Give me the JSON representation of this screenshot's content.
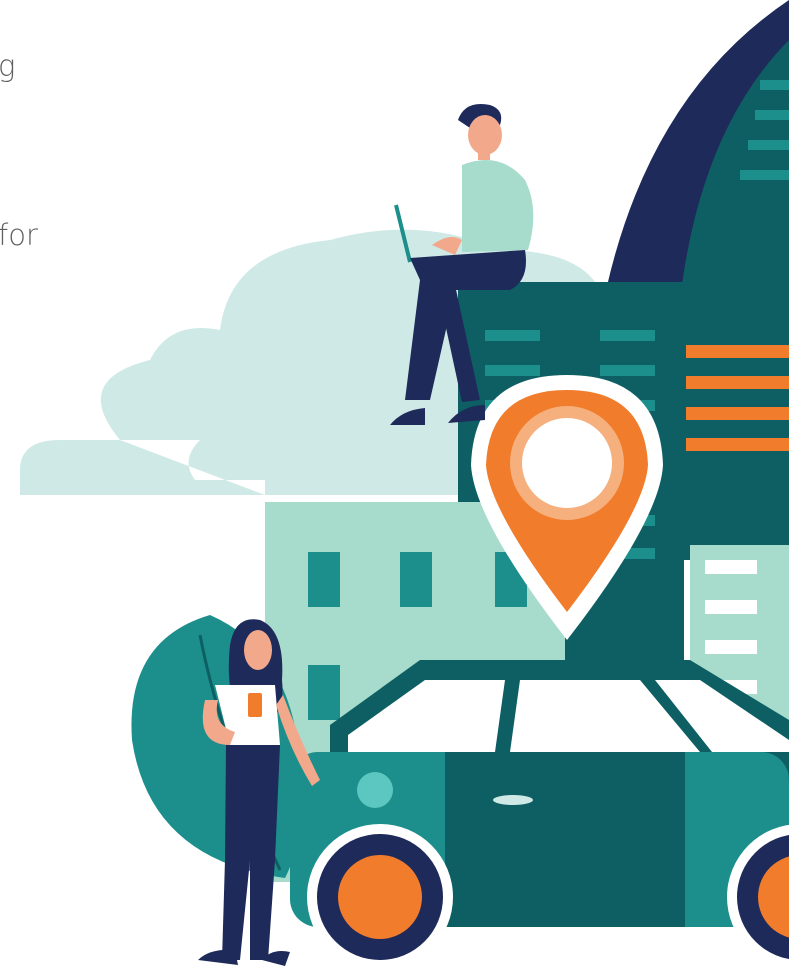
{
  "text_fragments": [
    {
      "text": "g"
    },
    {
      "text": "for"
    }
  ],
  "illustration": {
    "subject": "city-ride-hailing-scene",
    "colors": {
      "navy": "#1e2a5a",
      "deep_teal": "#0e5f63",
      "teal": "#1c8f8c",
      "mint": "#a7dccd",
      "pale_cloud": "#cfeae6",
      "orange": "#f07c2c",
      "peach": "#f6b07e",
      "skin": "#f2a88a",
      "white": "#ffffff"
    },
    "elements": [
      "cloud",
      "dome-tower",
      "back-building",
      "front-building",
      "map-pin-icon",
      "man-with-laptop",
      "woman-with-phone",
      "leaf",
      "car"
    ]
  }
}
